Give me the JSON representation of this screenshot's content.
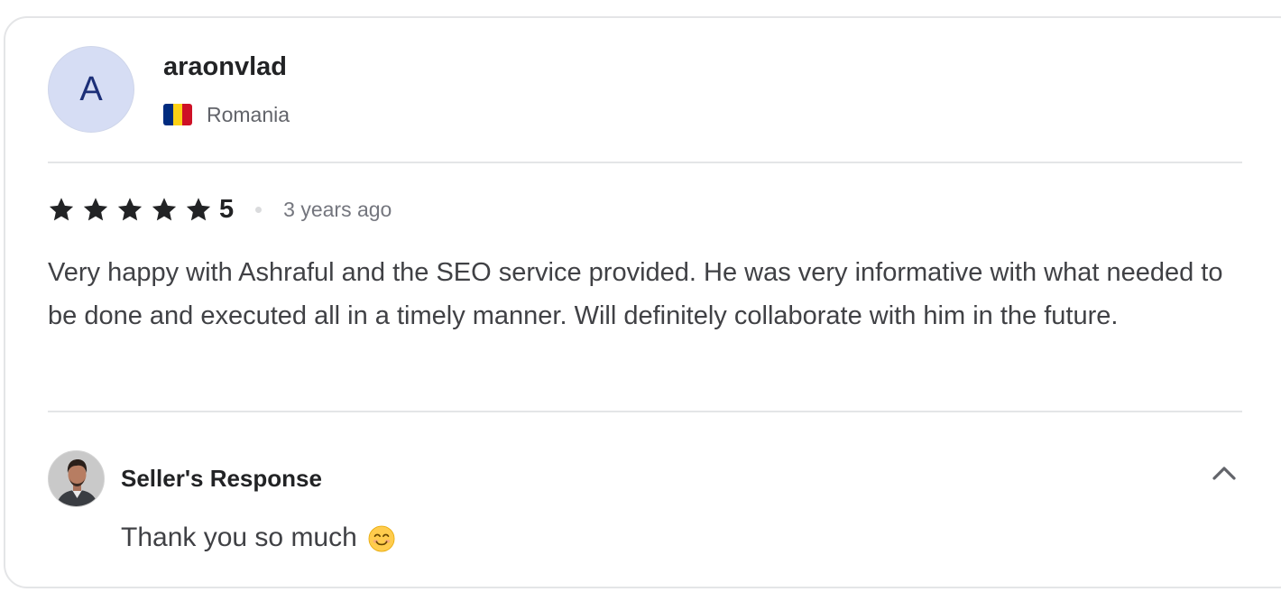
{
  "reviewer": {
    "avatar_initial": "A",
    "name": "araonvlad",
    "country": "Romania",
    "flag_colors": [
      "#002b7f",
      "#fcd116",
      "#ce1126"
    ]
  },
  "rating": {
    "stars": 5,
    "max_stars": 5,
    "value_label": "5",
    "time_ago": "3 years ago"
  },
  "review": {
    "text": "Very happy with Ashraful and the SEO service provided. He was very informative with what needed to be done and executed all in a timely manner. Will definitely collaborate with him in the future."
  },
  "seller_response": {
    "title": "Seller's Response",
    "text": "Thank you so much",
    "emoji_icon": "smiling-face-icon",
    "collapse_icon": "chevron-up-icon"
  },
  "colors": {
    "star": "#222325",
    "avatar_bg": "#d6ddf4",
    "avatar_text": "#1c2f78",
    "divider": "#e4e5e7"
  }
}
